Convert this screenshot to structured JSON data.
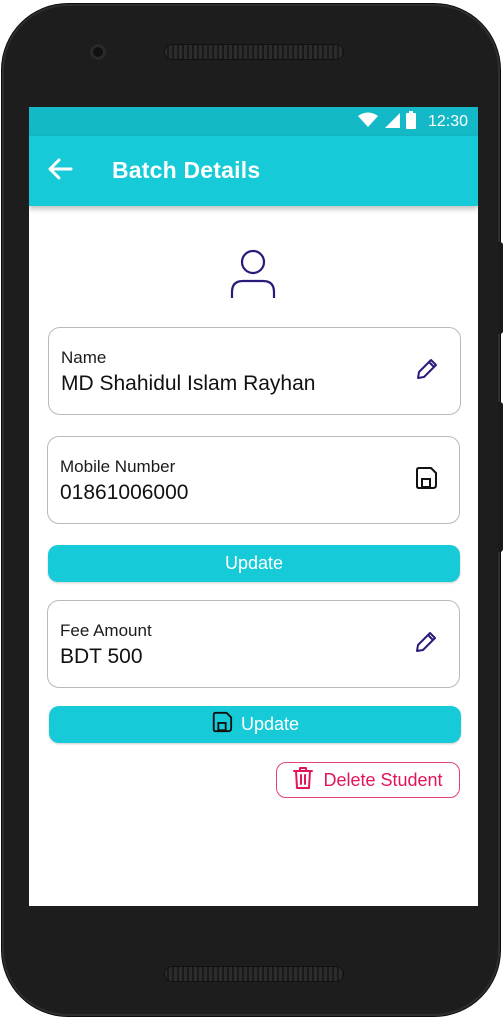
{
  "status_bar": {
    "time": "12:30",
    "icons": [
      "wifi-icon",
      "cellular-signal-icon",
      "battery-icon"
    ]
  },
  "app_bar": {
    "title": "Batch Details",
    "back_icon": "arrow-left-icon"
  },
  "profile": {
    "icon": "user-icon"
  },
  "name_field": {
    "label": "Name",
    "value": "MD Shahidul Islam Rayhan",
    "action_icon": "pencil-icon"
  },
  "mobile_field": {
    "label": "Mobile Number",
    "value": "01861006000",
    "action_icon": "save-icon"
  },
  "update_mobile": {
    "label": "Update"
  },
  "fee_field": {
    "label": "Fee Amount",
    "value": "BDT 500",
    "action_icon": "pencil-icon"
  },
  "update_fee": {
    "label": "Update",
    "icon": "save-icon"
  },
  "delete": {
    "label": "Delete Student",
    "icon": "trash-icon"
  },
  "colors": {
    "accent": "#17cad8",
    "status_bar": "#13b9c6",
    "icon": "#2a1a7a",
    "danger": "#e2145c"
  }
}
